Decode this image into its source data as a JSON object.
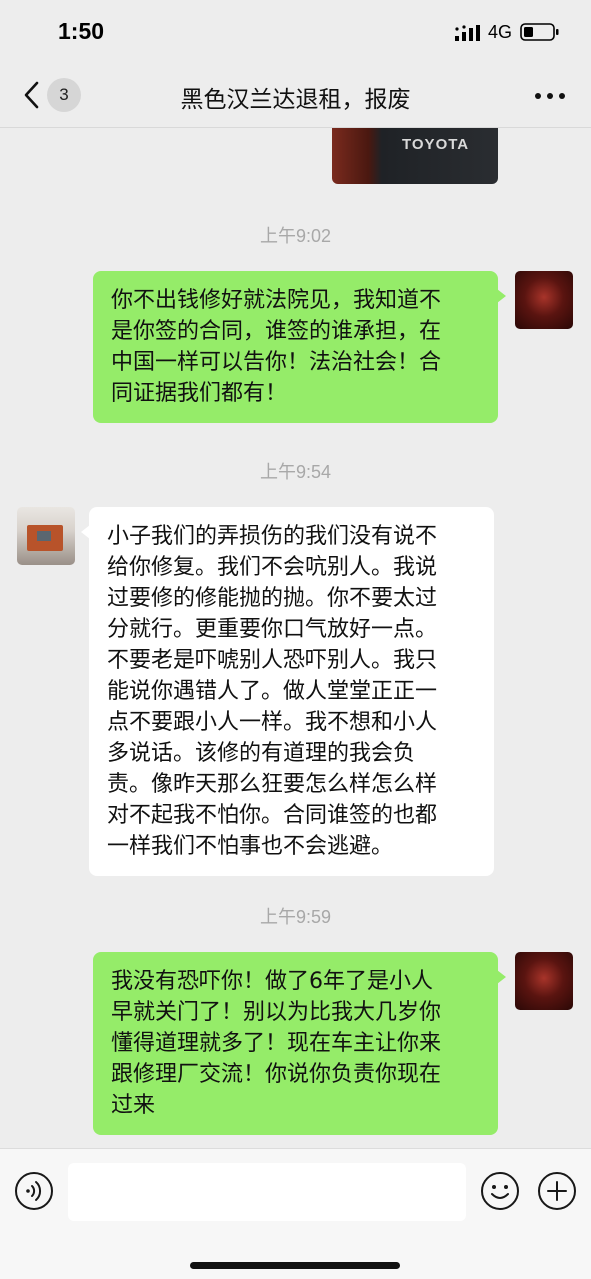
{
  "status_bar": {
    "time": "1:50",
    "network": "4G",
    "icons": [
      "signal-icon",
      "battery-icon"
    ]
  },
  "nav": {
    "unread_count": "3",
    "title": "黑色汉兰达退租，报废",
    "icons": [
      "chevron-left-icon",
      "more-icon"
    ]
  },
  "messages": [
    {
      "type": "image",
      "direction": "sent",
      "image_text": "TOYOTA"
    },
    {
      "type": "timestamp",
      "text": "上午9:02"
    },
    {
      "type": "text",
      "direction": "sent",
      "lines": [
        "你不出钱修好就法院见，我知道不",
        "是你签的合同，谁签的谁承担，在",
        "中国一样可以告你！法治社会！合",
        "同证据我们都有！"
      ]
    },
    {
      "type": "timestamp",
      "text": "上午9:54"
    },
    {
      "type": "text",
      "direction": "received",
      "lines": [
        "小子我们的弄损伤的我们没有说不",
        "给你修复。我们不会吭别人。我说",
        "过要修的修能抛的抛。你不要太过",
        "分就行。更重要你口气放好一点。",
        "不要老是吓唬别人恐吓别人。我只",
        "能说你遇错人了。做人堂堂正正一",
        "点不要跟小人一样。我不想和小人",
        "多说话。该修的有道理的我会负",
        "责。像昨天那么狂要怎么样怎么样",
        "对不起我不怕你。合同谁签的也都",
        "一样我们不怕事也不会逃避。"
      ]
    },
    {
      "type": "timestamp",
      "text": "上午9:59"
    },
    {
      "type": "text",
      "direction": "sent",
      "lines": [
        "我没有恐吓你！做了6年了是小人",
        "早就关门了！别以为比我大几岁你",
        "懂得道理就多了！现在车主让你来",
        "跟修理厂交流！你说你负责你现在",
        "过来"
      ]
    }
  ],
  "input_bar": {
    "placeholder": "",
    "icons": [
      "voice-icon",
      "emoji-icon",
      "plus-icon"
    ]
  },
  "colors": {
    "background": "#ededed",
    "sent_bubble": "#95ec69",
    "received_bubble": "#ffffff",
    "timestamp": "#a8a8a8"
  }
}
